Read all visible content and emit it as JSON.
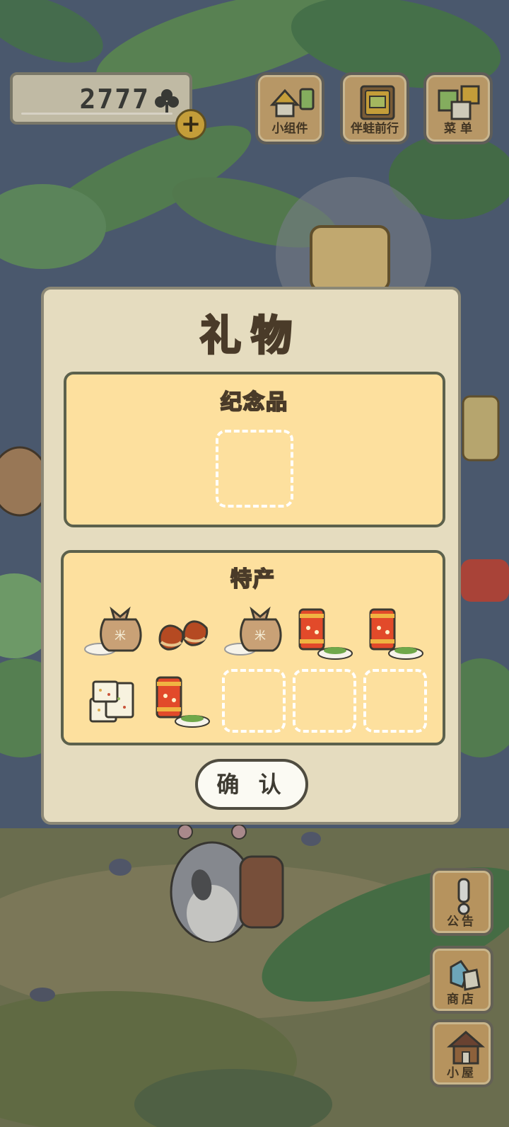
{
  "currency": {
    "value": "2777",
    "icon": "clover-icon"
  },
  "top_menu": {
    "widgets_label": "小组件",
    "travel_label": "伴蛙前行",
    "menu_label": "菜 单"
  },
  "dialog": {
    "title": "礼物",
    "souvenir": {
      "title": "纪念品",
      "filled_slots": 0,
      "total_slots": 1
    },
    "specialty": {
      "title": "特产",
      "items": [
        "rice-sack-icon",
        "chestnuts-icon",
        "rice-sack-icon",
        "tea-can-icon",
        "tea-can-icon",
        "rice-cake-icon",
        "tea-can-icon"
      ],
      "empty_slots": 3
    },
    "confirm_label": "确 认"
  },
  "side_menu": {
    "notice_label": "公告",
    "shop_label": "商店",
    "house_label": "小屋"
  },
  "colors": {
    "dialog_bg": "#e5dcbf",
    "panel_bg": "#fde09e",
    "wood": "#d8ad6a",
    "outline": "#4a3b29"
  }
}
